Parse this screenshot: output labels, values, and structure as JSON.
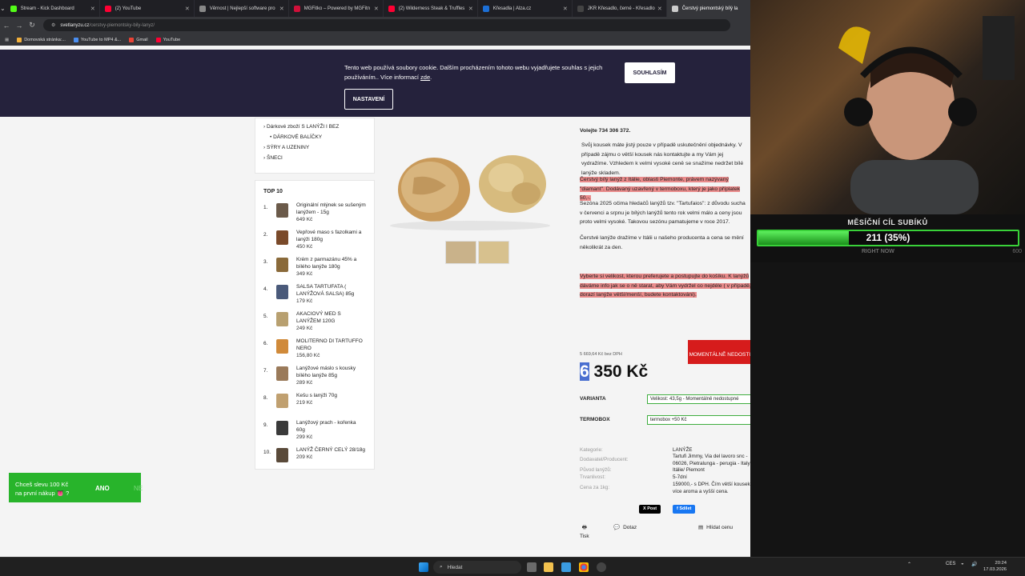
{
  "browser": {
    "tabs": [
      {
        "label": "Stream - Kick Dashboard",
        "color": "#53fc18"
      },
      {
        "label": "(2) YouTube",
        "color": "#ff0033"
      },
      {
        "label": "Věrnost | Nejlepší software pro",
        "color": "#888888"
      },
      {
        "label": "MGFitko – Powered by MGFitn",
        "color": "#d0103a"
      },
      {
        "label": "(2) Wilderness Steak & Truffles",
        "color": "#ff0033"
      },
      {
        "label": "Křesadla | Alza.cz",
        "color": "#1c6fd6"
      },
      {
        "label": "JKR Křesadlo, černé - Křesadlo",
        "color": "#444444"
      },
      {
        "label": "Čerstvý piemontský bílý la",
        "color": "#cccccc"
      }
    ],
    "url_host": "svetlanyzu.cz",
    "url_path": "/cerstvy-piemontsky-bily-lanyz/",
    "bookmarks": [
      "Domovská stránka:...",
      "YouTube to MP4 &...",
      "Gmail",
      "YouTube"
    ]
  },
  "cookie": {
    "text_a": "Tento web používá soubory cookie. Dalším procházením tohoto webu vyjadřujete souhlas s jejich používáním.. Více informací ",
    "link": "zde",
    "accept": "SOUHLASÍM",
    "settings": "NASTAVENÍ"
  },
  "sidebar": {
    "categories": [
      "Dárkové zboží S LANÝŽI I BEZ",
      "DÁRKOVÉ BALÍČKY",
      "SÝRY A UZENINY",
      "ŠNECI"
    ],
    "top_title": "TOP 10",
    "top": [
      {
        "n": "1.",
        "name": "Originální mlýnek se sušeným lanýžem - 15g",
        "price": "649 Kč"
      },
      {
        "n": "2.",
        "name": "Vepřové maso s fazolkami a lanýži 180g",
        "price": "450 Kč"
      },
      {
        "n": "3.",
        "name": "Krém z parmazánu 45% a bílého lanýže 180g",
        "price": "349 Kč"
      },
      {
        "n": "4.",
        "name": "SALSA TARTUFATA ( LANÝŽOVÁ SALSA) 85g",
        "price": "179 Kč"
      },
      {
        "n": "5.",
        "name": "AKACIOVÝ MED S LANÝŽEM 120G",
        "price": "249 Kč"
      },
      {
        "n": "6.",
        "name": "MOLITERNO DI TARTUFFO NERO",
        "price": "156,80 Kč"
      },
      {
        "n": "7.",
        "name": "Lanýžové máslo s kousky bílého lanýže 85g",
        "price": "289 Kč"
      },
      {
        "n": "8.",
        "name": "Kešu s lanýži 70g",
        "price": "219 Kč"
      },
      {
        "n": "9.",
        "name": "Lanýžový prach - kořenka 60g",
        "price": "299 Kč"
      },
      {
        "n": "10.",
        "name": "LANÝŽ ČERNÝ CELÝ 28/18g",
        "price": "209 Kč"
      }
    ]
  },
  "product": {
    "phone": "Volejte 734 306 372.",
    "p1": "Svůj kousek máte jistý pouze v případě uskutečnění objednávky. V případě zájmu o větší kousek nás kontaktujte a my Vám jej vydražíme. Vzhledem k velmi vysoké ceně se snažíme nedržet bílé lanýže skladem.",
    "p2": "Čerstvý bílý lanýž z Itálie, oblasti Piemonte, právem nazývaný \"diamant\". Dodávaný uzavřený v termoboxu, který je jako příplatek 50,-.",
    "p3": "Sezóna 2025 očima hledačů lanýžů tzv. \"Tartufaios\": z důvodu sucha v červenci a srpnu je bílých lanýžů tento rok velmi málo a ceny jsou proto velmi vysoké. Takovou sezónu pamatujeme v roce 2017.",
    "p4": "Čerstvé lanýže dražíme v Itálii u našeho producenta a cena se mění několikrát za den.",
    "p5": "Vyberte si velikost, kterou preferujete a postupujte do košíku. K lanýžů dáváme info jak se o ně starat, aby Vám vydržel co nejdéle ( v případě, že dorazí lanýže větší/menší, budete kontaktováni).",
    "price_bez": "5 669,64 Kč bez DPH",
    "price_first": "6",
    "price_rest": " 350 Kč",
    "unavailable": "MOMENTÁLNĚ NEDOSTUPNÉ",
    "variant_label": "VARIANTA",
    "variant_value": "Velikost: 43,5g - Momentálně nedostupné",
    "termobox_label": "TERMOBOX",
    "termobox_value": "termobox +50 Kč",
    "meta": [
      {
        "k": "Kategorie:",
        "v": "LANÝŽE"
      },
      {
        "k": "Dodavatel/Producent:",
        "v": "Tartufi Jimmy, Via del lavoro snc - 06026, Pietralunga - perugia - Italy"
      },
      {
        "k": "Původ lanýžů:",
        "v": "Itálie/ Piemont"
      },
      {
        "k": "Trvanlivost:",
        "v": "5-7dní"
      },
      {
        "k": "Cena za 1kg:",
        "v": "159000,- s DPH. Čím větší kousek, tím více aroma a vyšší cena."
      }
    ],
    "post": "X Post",
    "share": "f Sdílet",
    "print": "Tisk",
    "ask": "Dotaz",
    "watch": "Hlídat cenu"
  },
  "promo": {
    "text1": "Chceš slevu 100 Kč",
    "text2": "na první nákup 👅 ?",
    "yes": "ANO",
    "no": "NE"
  },
  "goal": {
    "title": "MĚSÍČNÍ CÍL SUBÍKŮ",
    "value": "211 (35%)",
    "fraction": 0.35,
    "sub": "RIGHT NOW",
    "max": "600"
  },
  "taskbar": {
    "search": "Hledat",
    "lang": "CES",
    "time": "20:24",
    "date": "17.03.2026"
  }
}
